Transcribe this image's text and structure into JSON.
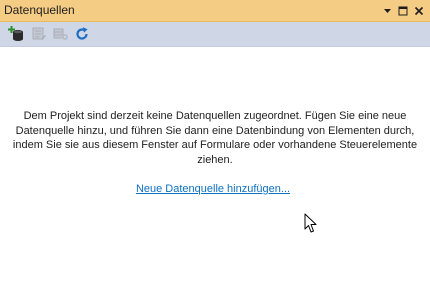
{
  "window": {
    "title": "Datenquellen"
  },
  "titlebar_buttons": {
    "dropdown_icon": "chevron-down-icon",
    "maximize_icon": "maximize-icon",
    "close_icon": "close-icon"
  },
  "toolbar": {
    "items": [
      {
        "icon": "add-datasource-icon",
        "enabled": true
      },
      {
        "icon": "edit-dataset-icon",
        "enabled": false
      },
      {
        "icon": "configure-dataset-icon",
        "enabled": false
      },
      {
        "icon": "refresh-icon",
        "enabled": true
      }
    ]
  },
  "main": {
    "message": "Dem Projekt sind derzeit keine Datenquellen zugeordnet. Fügen Sie eine neue Datenquelle hinzu, und führen Sie dann eine Datenbindung von Elementen durch, indem Sie sie aus diesem Fenster auf Formulare oder vorhandene Steuerelemente ziehen.",
    "link_label": "Neue Datenquelle hinzufügen..."
  },
  "colors": {
    "titlebar_bg": "#f5cc84",
    "toolbar_bg": "#cfd6e5",
    "link": "#0e70c0",
    "refresh_icon": "#1f6fc5"
  }
}
